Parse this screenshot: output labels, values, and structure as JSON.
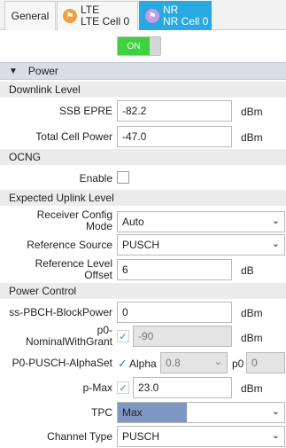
{
  "tabs": {
    "general": "General",
    "lte_line1": "LTE",
    "lte_line2": "LTE Cell 0",
    "nr_line1": "NR",
    "nr_line2": "NR Cell 0"
  },
  "toggle": {
    "label": "ON"
  },
  "power": {
    "title": "Power",
    "downlink_level": "Downlink Level",
    "ssb_epre": {
      "label": "SSB EPRE",
      "value": "-82.2",
      "unit": "dBm"
    },
    "total_cell_power": {
      "label": "Total Cell Power",
      "value": "-47.0",
      "unit": "dBm"
    },
    "ocng": "OCNG",
    "enable_label": "Enable",
    "expected_uplink": "Expected Uplink Level",
    "receiver_config_mode": {
      "label_line1": "Receiver Config",
      "label_line2": "Mode",
      "value": "Auto"
    },
    "reference_source": {
      "label": "Reference Source",
      "value": "PUSCH"
    },
    "reference_level_offset": {
      "label_line1": "Reference Level",
      "label_line2": "Offset",
      "value": "6",
      "unit": "dB"
    },
    "power_control": "Power Control",
    "ss_pbch": {
      "label": "ss-PBCH-BlockPower",
      "value": "0",
      "unit": "dBm"
    },
    "p0_nominal": {
      "label_line1": "p0-",
      "label_line2": "NominalWithGrant",
      "value": "-90",
      "unit": "dBm"
    },
    "p0_pusch": {
      "label": "P0-PUSCH-AlphaSet",
      "alpha_label": "Alpha",
      "alpha_value": "0.8",
      "p0_label": "p0",
      "p0_value": "0"
    },
    "p_max": {
      "label": "p-Max",
      "value": "23.0",
      "unit": "dBm"
    },
    "tpc": {
      "label": "TPC",
      "value": "Max"
    },
    "channel_type": {
      "label": "Channel Type",
      "value": "PUSCH"
    }
  },
  "icons": {
    "lte": "lte-cell-icon",
    "nr": "nr-cell-icon",
    "collapse": "triangle-down-icon",
    "dropdown": "chevron-down-icon",
    "check": "checkmark-icon"
  },
  "colors": {
    "nr_tab": "#29a9e1",
    "toggle_on": "#3fd13f",
    "lte_icon": "#f0a03c",
    "nr_icon": "#c59be8",
    "tpc_fill": "#7e96c2"
  }
}
